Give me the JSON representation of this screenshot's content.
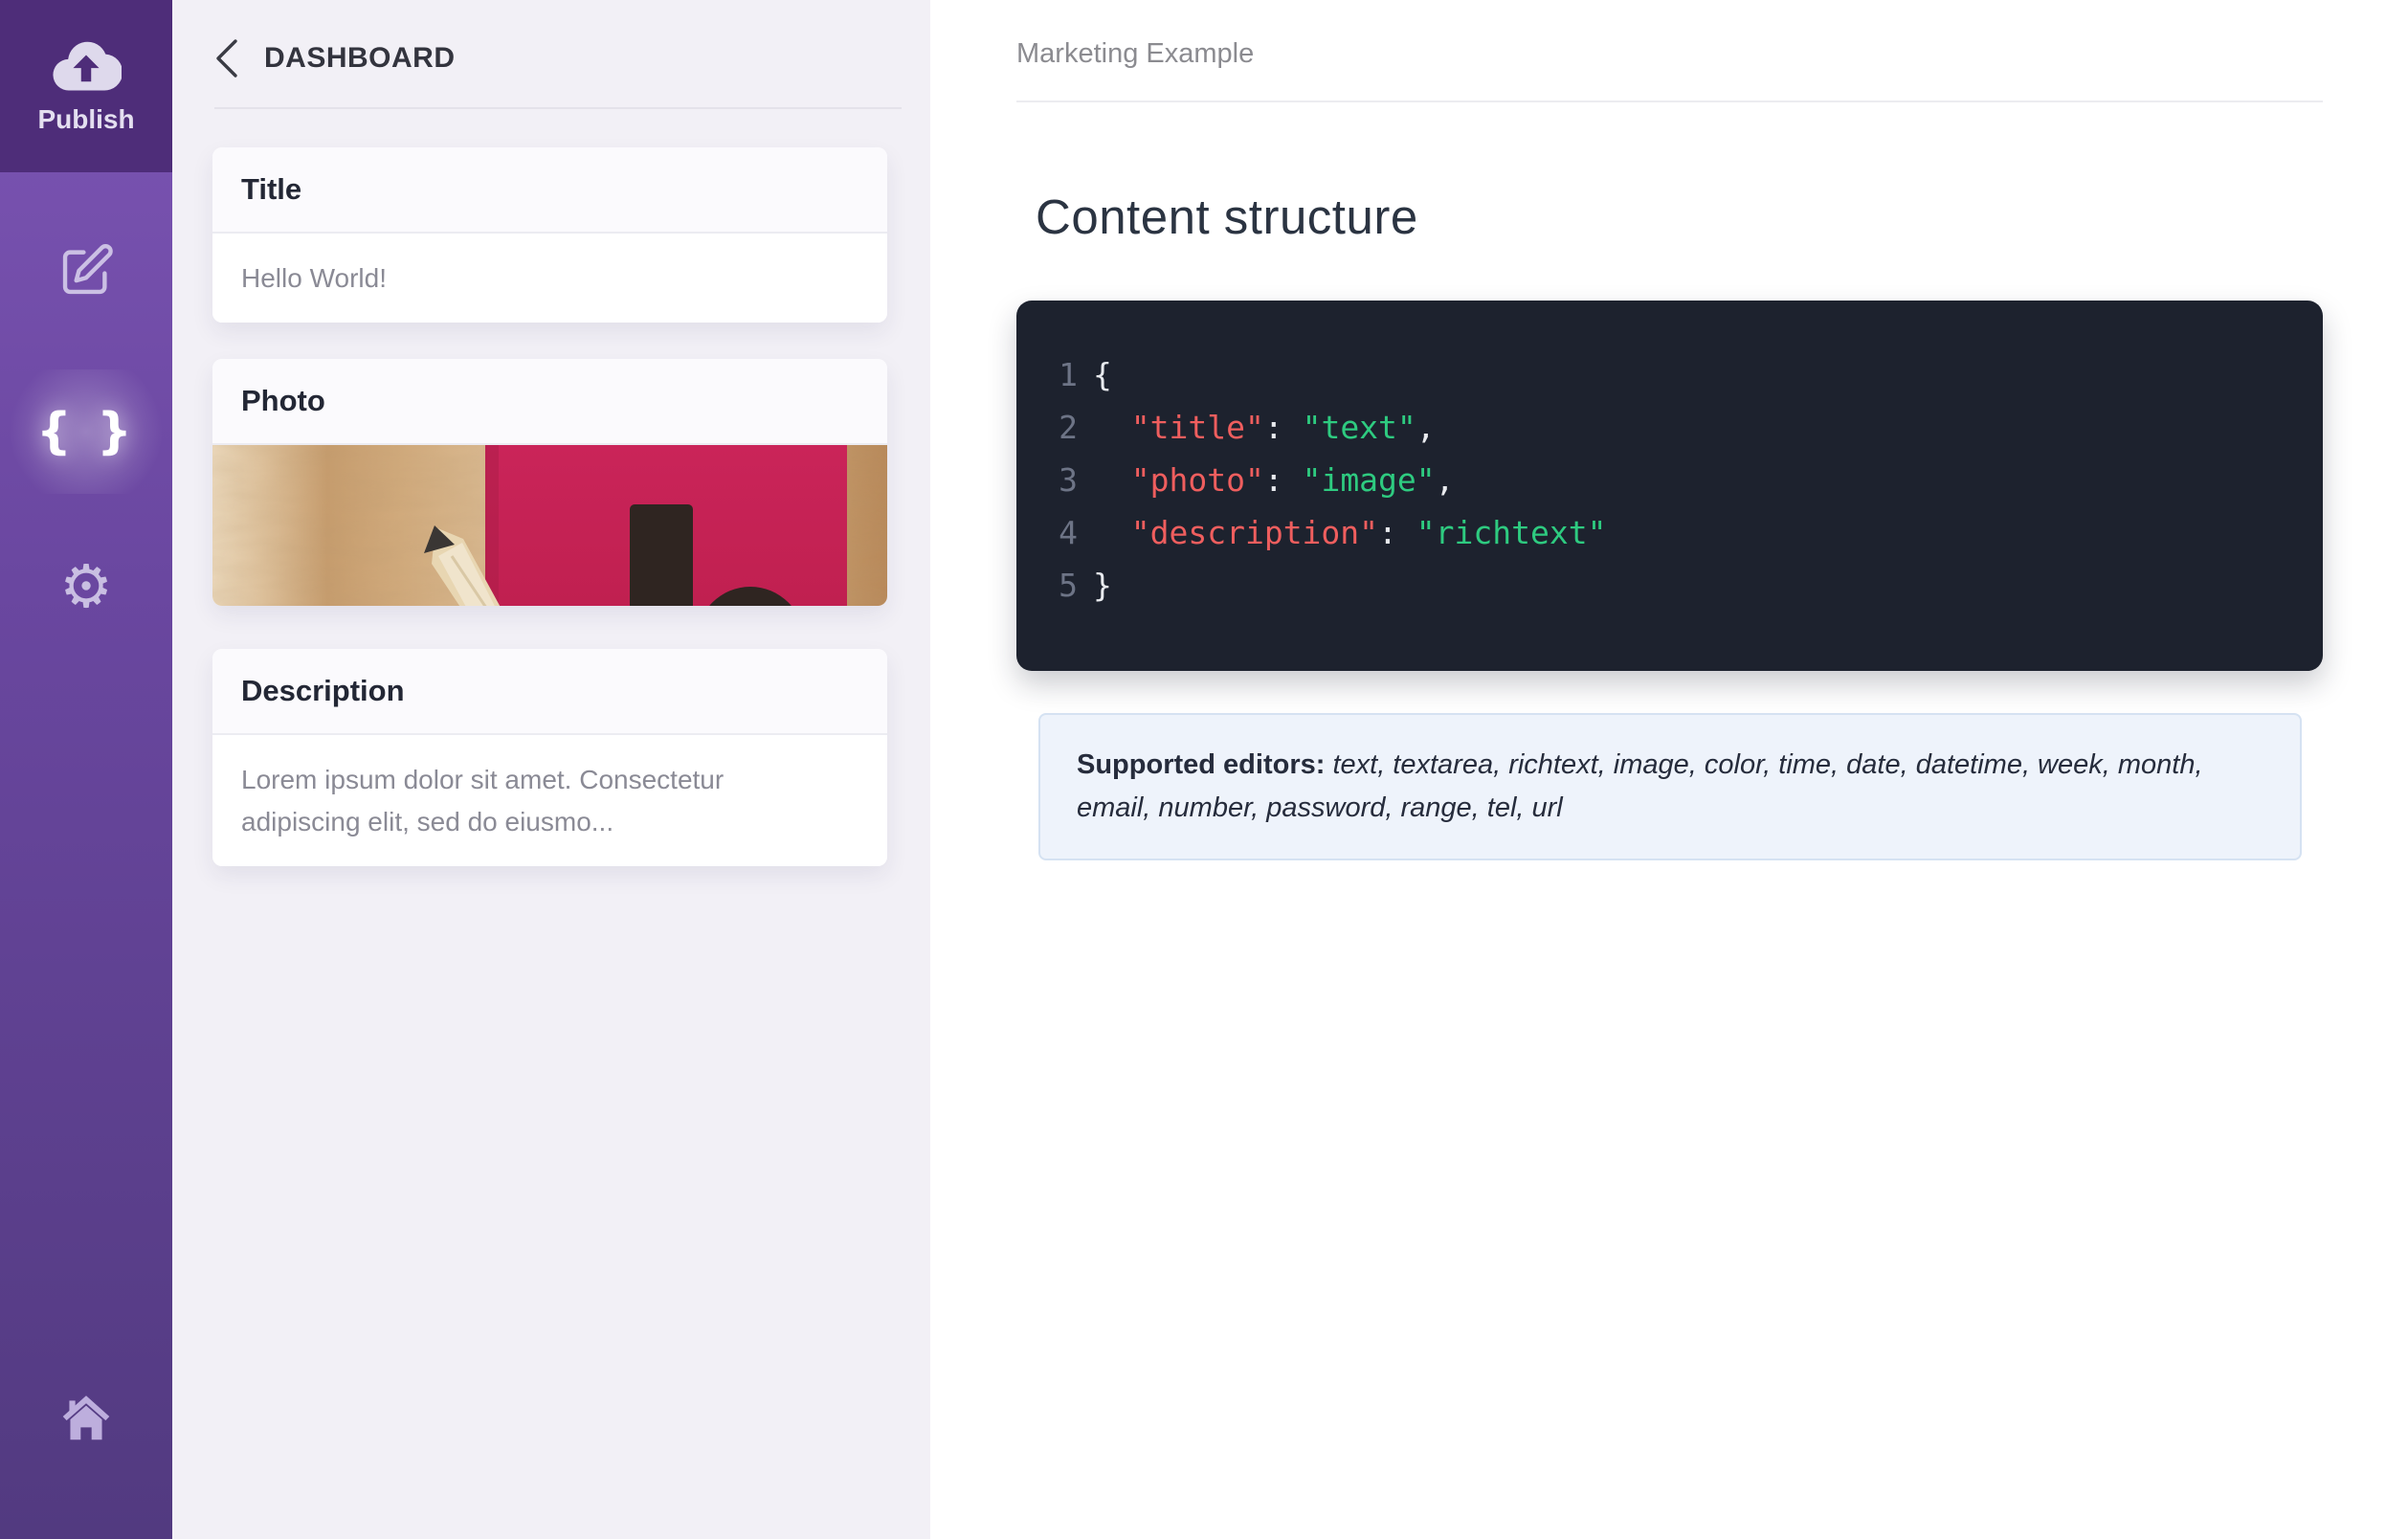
{
  "sidebar": {
    "publish_label": "Publish",
    "braces_glyph": "{ }",
    "gear_glyph": "⚙"
  },
  "panel": {
    "back_label": "DASHBOARD",
    "cards": [
      {
        "title": "Title",
        "value": "Hello World!"
      },
      {
        "title": "Photo"
      },
      {
        "title": "Description",
        "value": "Lorem ipsum dolor sit amet. Consectetur adipiscing elit, sed do eiusmo..."
      }
    ]
  },
  "main": {
    "breadcrumb": "Marketing Example",
    "title": "Content structure",
    "code": {
      "lines": [
        {
          "num": "1",
          "tokens": [
            {
              "c": "punct",
              "t": "{"
            }
          ]
        },
        {
          "num": "2",
          "tokens": [
            {
              "c": "punct",
              "t": "  "
            },
            {
              "c": "key",
              "t": "\"title\""
            },
            {
              "c": "punct",
              "t": ": "
            },
            {
              "c": "val",
              "t": "\"text\""
            },
            {
              "c": "punct",
              "t": ","
            }
          ]
        },
        {
          "num": "3",
          "tokens": [
            {
              "c": "punct",
              "t": "  "
            },
            {
              "c": "key",
              "t": "\"photo\""
            },
            {
              "c": "punct",
              "t": ": "
            },
            {
              "c": "val",
              "t": "\"image\""
            },
            {
              "c": "punct",
              "t": ","
            }
          ]
        },
        {
          "num": "4",
          "tokens": [
            {
              "c": "punct",
              "t": "  "
            },
            {
              "c": "key",
              "t": "\"description\""
            },
            {
              "c": "punct",
              "t": ": "
            },
            {
              "c": "val",
              "t": "\"richtext\""
            }
          ]
        },
        {
          "num": "5",
          "tokens": [
            {
              "c": "punct",
              "t": "}"
            }
          ]
        }
      ]
    },
    "note": {
      "bold": "Supported editors:",
      "list": " text, textarea, richtext, image, color, time, date, datetime, week, month, email, number, password, range, tel, url"
    }
  },
  "colors": {
    "publish_bg": "#4e2d79",
    "sidebar_purple": "#6a47a0",
    "code_bg": "#1d222e",
    "code_key": "#ef5e5e",
    "code_value": "#2ecb80",
    "note_bg": "#eef3fb",
    "photo_pink": "#c92355"
  }
}
